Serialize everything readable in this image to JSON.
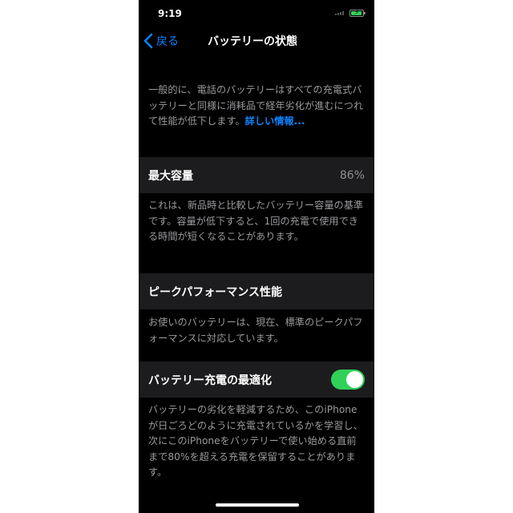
{
  "status_bar": {
    "time": "9:19"
  },
  "nav": {
    "back_label": "戻る",
    "title": "バッテリーの状態"
  },
  "intro": {
    "text": "一般的に、電話のバッテリーはすべての充電式バッテリーと同様に消耗品で経年劣化が進むにつれて性能が低下します。",
    "link": "詳しい情報..."
  },
  "max_capacity": {
    "label": "最大容量",
    "value": "86%",
    "description": "これは、新品時と比較したバッテリー容量の基準です。容量が低下すると、1回の充電で使用できる時間が短くなることがあります。"
  },
  "peak_performance": {
    "label": "ピークパフォーマンス性能",
    "description": "お使いのバッテリーは、現在、標準のピークパフォーマンスに対応しています。"
  },
  "optimized_charging": {
    "label": "バッテリー充電の最適化",
    "enabled": true,
    "description": "バッテリーの劣化を軽減するため、このiPhoneが日ごろどのように充電されているかを学習し、次にこのiPhoneをバッテリーで使い始める直前まで80%を超える充電を保留することがあります。"
  },
  "colors": {
    "background": "#000000",
    "row_background": "#1c1c1e",
    "accent_blue": "#0a84ff",
    "toggle_green": "#30d158",
    "secondary_text": "#9a9a9e"
  }
}
